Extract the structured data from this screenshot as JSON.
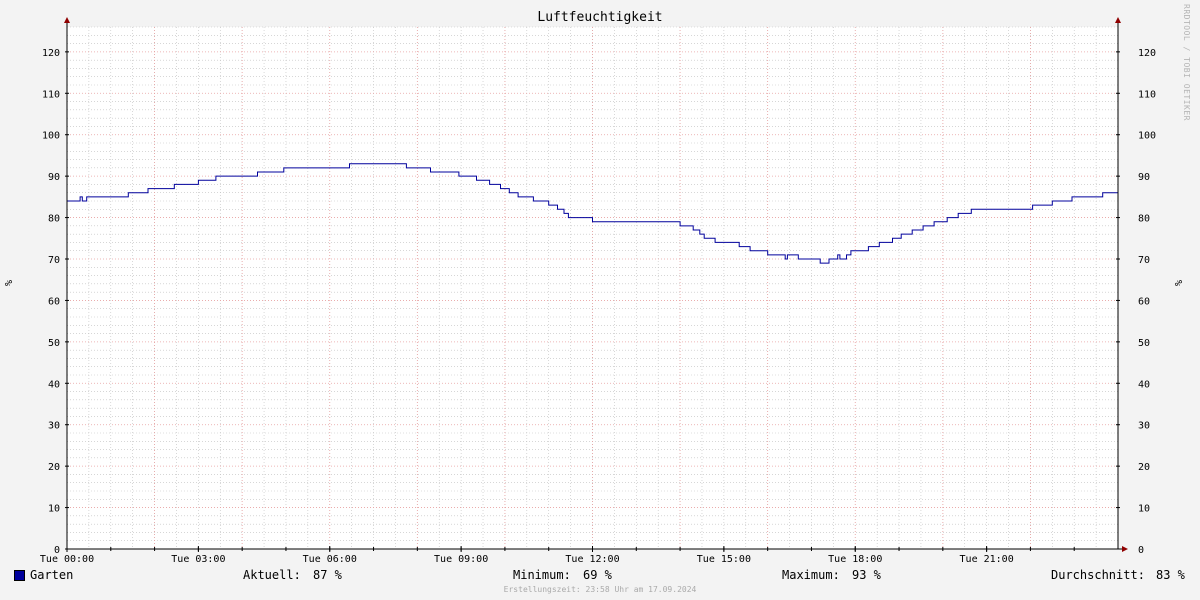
{
  "chart_data": {
    "type": "line",
    "title": "Luftfeuchtigkeit",
    "ylabel": "%",
    "ylim": [
      0,
      126
    ],
    "y_ticks": [
      0,
      10,
      20,
      30,
      40,
      50,
      60,
      70,
      80,
      90,
      100,
      110,
      120
    ],
    "x_ticks": [
      {
        "h": 0,
        "label": "Tue 00:00"
      },
      {
        "h": 3,
        "label": "Tue 03:00"
      },
      {
        "h": 6,
        "label": "Tue 06:00"
      },
      {
        "h": 9,
        "label": "Tue 09:00"
      },
      {
        "h": 12,
        "label": "Tue 12:00"
      },
      {
        "h": 15,
        "label": "Tue 15:00"
      },
      {
        "h": 18,
        "label": "Tue 18:00"
      },
      {
        "h": 21,
        "label": "Tue 21:00"
      }
    ],
    "xlim_hours": [
      0,
      24
    ],
    "grid": true,
    "series": [
      {
        "name": "Garten",
        "color": "#00009c",
        "x_hours": [
          0.0,
          0.3,
          0.35,
          0.45,
          0.5,
          1.4,
          1.85,
          2.45,
          3.0,
          3.4,
          4.35,
          4.95,
          6.45,
          7.75,
          8.3,
          8.95,
          9.35,
          9.65,
          9.9,
          10.1,
          10.3,
          10.65,
          11.0,
          11.2,
          11.35,
          11.45,
          11.55,
          11.65,
          12.0,
          13.0,
          14.0,
          14.3,
          14.45,
          14.55,
          14.8,
          15.35,
          15.6,
          16.0,
          16.4,
          16.45,
          16.55,
          16.7,
          17.15,
          17.2,
          17.4,
          17.45,
          17.6,
          17.65,
          17.8,
          17.9,
          18.3,
          18.55,
          18.85,
          19.05,
          19.3,
          19.55,
          19.8,
          20.1,
          20.35,
          20.65,
          22.05,
          22.5,
          22.95,
          23.65,
          24.0
        ],
        "y_values": [
          84,
          85,
          84,
          85,
          85,
          86,
          87,
          88,
          89,
          90,
          91,
          92,
          93,
          92,
          91,
          90,
          89,
          88,
          87,
          86,
          85,
          84,
          83,
          82,
          81,
          80,
          80,
          80,
          79,
          79,
          78,
          77,
          76,
          75,
          74,
          73,
          72,
          71,
          70,
          71,
          71,
          70,
          70,
          69,
          70,
          70,
          71,
          70,
          71,
          72,
          73,
          74,
          75,
          76,
          77,
          78,
          79,
          80,
          81,
          82,
          83,
          84,
          85,
          86,
          87
        ]
      }
    ]
  },
  "legend": {
    "series_name": "Garten",
    "current_label": "Aktuell:",
    "current_value": "87 %",
    "min_label": "Minimum:",
    "min_value": "69 %",
    "max_label": "Maximum:",
    "max_value": "93 %",
    "avg_label": "Durchschnitt:",
    "avg_value": "83 %"
  },
  "watermark": "RRDTOOL / TOBI OETIKER",
  "footer": "Erstellungszeit: 23:58 Uhr am 17.09.2024",
  "colors": {
    "background": "#f3f3f3",
    "canvas": "#ffffff",
    "minor_grid": "#bfbfbf",
    "major_grid": "#e8a0a0",
    "axis": "#000000",
    "arrow": "#900000",
    "series": "#00009c"
  }
}
